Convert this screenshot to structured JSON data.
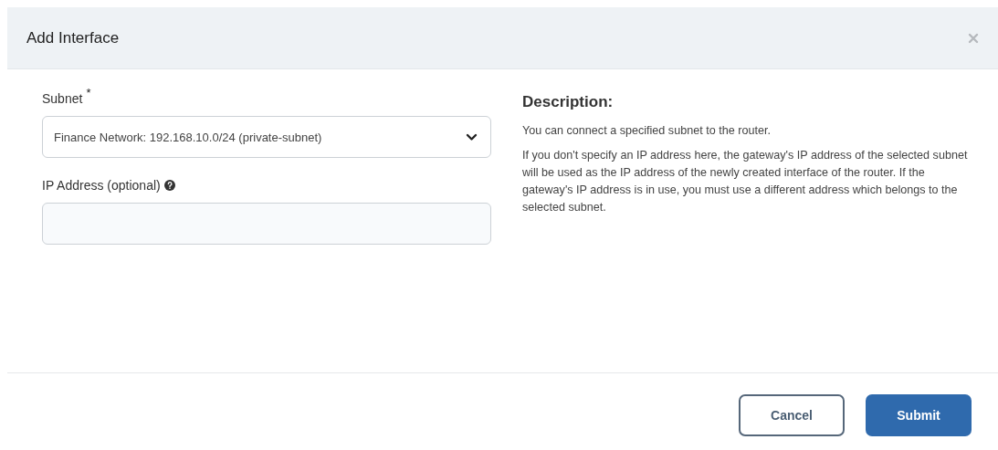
{
  "dialog": {
    "title": "Add Interface"
  },
  "fields": [
    {
      "kind": "select",
      "label": "Subnet",
      "required_mark": "*",
      "value": "Finance Network: 192.168.10.0/24 (private-subnet)"
    },
    {
      "kind": "text",
      "label": "IP Address (optional)",
      "help": true
    }
  ],
  "description": {
    "heading": "Description:",
    "paragraphs": [
      "You can connect a specified subnet to the router.",
      "If you don't specify an IP address here, the gateway's IP address of the selected subnet will be used as the IP address of the newly created interface of the router. If the gateway's IP address is in use, you must use a different address which belongs to the selected subnet."
    ]
  },
  "buttons": [
    {
      "label": "Cancel",
      "kind": "secondary"
    },
    {
      "label": "Submit",
      "kind": "primary"
    }
  ]
}
